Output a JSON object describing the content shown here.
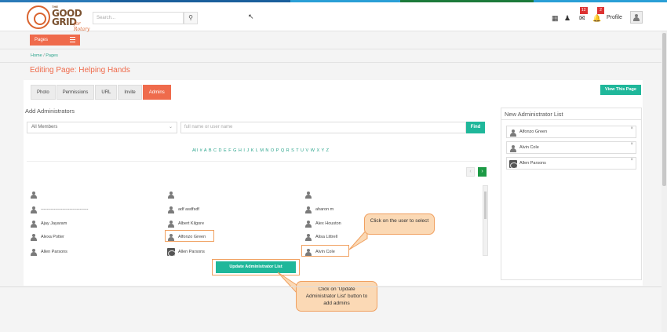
{
  "colors": {
    "accent": "#ef6b4c",
    "teal": "#1fb79a",
    "green": "#1c9a45",
    "link": "#2aa48c"
  },
  "header": {
    "logo": {
      "the": "THE",
      "line1": "GOOD",
      "line2": "GRID",
      "tagline": "for Rotary"
    },
    "search_placeholder": "Search...",
    "notif_messages": "12",
    "notif_alerts": "2",
    "profile_label": "Profile"
  },
  "sidebar_toggle": {
    "label": "Pages"
  },
  "breadcrumb": {
    "home": "Home",
    "sep": "/",
    "current": "Pages"
  },
  "page_title": "Editing Page: Helping Hands",
  "tabs": [
    "Photo",
    "Permissions",
    "URL",
    "Invite",
    "Admins"
  ],
  "view_button": "View This Page",
  "add_admins": {
    "title": "Add Administrators",
    "member_filter": "All Members",
    "name_placeholder": "full name or user name",
    "find_label": "Find",
    "alphabet": "All # A B C D E F G H I J K L M N O P Q R S T U V W X Y Z",
    "pager_prev": "‹",
    "pager_next": "›",
    "users": [
      {
        "name": "",
        "col": 0,
        "row": 0
      },
      {
        "name": "",
        "col": 1,
        "row": 0
      },
      {
        "name": "",
        "col": 2,
        "row": 0
      },
      {
        "name": "---------------------------------",
        "col": 0,
        "row": 1
      },
      {
        "name": "adf asdfsdf",
        "col": 1,
        "row": 1
      },
      {
        "name": "aharon m",
        "col": 2,
        "row": 1
      },
      {
        "name": "Ajay Jayaram",
        "col": 0,
        "row": 2
      },
      {
        "name": "Albert Kilgore",
        "col": 1,
        "row": 2
      },
      {
        "name": "Alex Houston",
        "col": 2,
        "row": 2
      },
      {
        "name": "Alexa Potter",
        "col": 0,
        "row": 3
      },
      {
        "name": "Alfonzo Green",
        "col": 1,
        "row": 3
      },
      {
        "name": "Alisa Littrell",
        "col": 2,
        "row": 3
      },
      {
        "name": "Allen Parsons",
        "col": 0,
        "row": 4
      },
      {
        "name": "Allen Parsons",
        "col": 1,
        "row": 4
      },
      {
        "name": "Alvin Cole",
        "col": 2,
        "row": 4
      }
    ],
    "update_label": "Update Administrator List"
  },
  "callouts": {
    "select_user": "Click on the user to select",
    "update_list": "Click on 'Update Administrator List' button to add admins"
  },
  "new_admin_list": {
    "title": "New Administrator List",
    "items": [
      {
        "name": "Alfonzo Green",
        "remove": "×"
      },
      {
        "name": "Alvin Cole",
        "remove": "×"
      },
      {
        "name": "Allen Parsons",
        "remove": "×"
      }
    ]
  }
}
